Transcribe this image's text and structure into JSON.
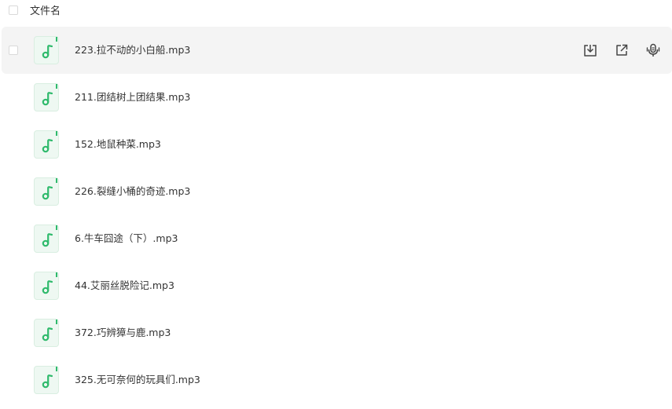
{
  "header": {
    "column_label": "文件名"
  },
  "files": [
    {
      "name": "223.拉不动的小白船.mp3",
      "hovered": true
    },
    {
      "name": "211.团结树上团结果.mp3",
      "hovered": false
    },
    {
      "name": "152.地鼠种菜.mp3",
      "hovered": false
    },
    {
      "name": "226.裂缝小桶的奇迹.mp3",
      "hovered": false
    },
    {
      "name": "6.牛车囧途（下）.mp3",
      "hovered": false
    },
    {
      "name": "44.艾丽丝脱险记.mp3",
      "hovered": false
    },
    {
      "name": "372.巧辨獐与鹿.mp3",
      "hovered": false
    },
    {
      "name": "325.无可奈何的玩具们.mp3",
      "hovered": false
    }
  ],
  "icons": {
    "file_type": "audio-file-icon",
    "row_actions": [
      "download-icon",
      "share-icon",
      "voice-icon"
    ]
  },
  "colors": {
    "accent_green": "#2fba6c",
    "hover_row_bg": "#f4f4f4",
    "text": "#333333"
  }
}
